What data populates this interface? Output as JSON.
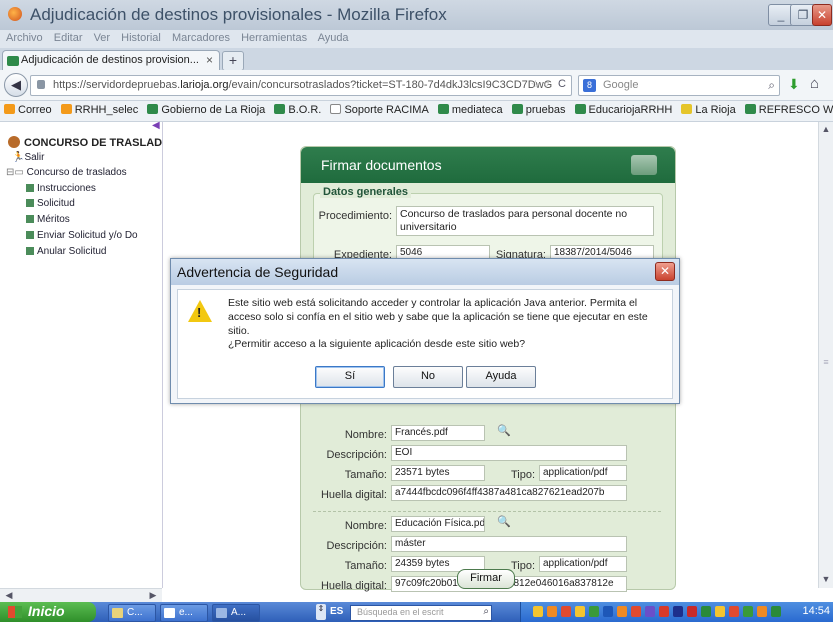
{
  "window": {
    "title": "Adjudicación de destinos provisionales - Mozilla Firefox",
    "minimize": "_",
    "restore": "❐",
    "close": "✕"
  },
  "menu": [
    "Archivo",
    "Editar",
    "Ver",
    "Historial",
    "Marcadores",
    "Herramientas",
    "Ayuda"
  ],
  "tab": {
    "label": "Adjudicación de destinos provision...",
    "close": "×",
    "new": "+"
  },
  "nav": {
    "url_prefix": "https://servidordepruebas.",
    "url_domain": "larioja.org",
    "url_suffix": "/evain/concursotraslados?ticket=ST-180-7d4dkJ3lcsI9C3CD7DwG",
    "search_engine": "Google"
  },
  "bookmarks": [
    {
      "label": "Correo",
      "icon": "o"
    },
    {
      "label": "RRHH_selec",
      "icon": "o"
    },
    {
      "label": "Gobierno de La Rioja",
      "icon": "g"
    },
    {
      "label": "B.O.R.",
      "icon": "g"
    },
    {
      "label": "Soporte RACIMA",
      "icon": "p"
    },
    {
      "label": "mediateca",
      "icon": "g"
    },
    {
      "label": "pruebas",
      "icon": "g"
    },
    {
      "label": "EducariojaRRHH",
      "icon": "g"
    },
    {
      "label": "La Rioja",
      "icon": "y"
    },
    {
      "label": "REFRESCO WEB",
      "icon": "g"
    }
  ],
  "sidebar": {
    "brand": "CONCURSO DE TRASLAD",
    "salir": "Salir",
    "root": "Concurso de traslados",
    "items": [
      "Instrucciones",
      "Solicitud",
      "Méritos",
      "Enviar Solicitud y/o Do",
      "Anular Solicitud"
    ]
  },
  "panel": {
    "title": "Firmar documentos",
    "legend": "Datos generales",
    "procedimiento_label": "Procedimiento:",
    "procedimiento_value": "Concurso de traslados para personal docente no universitario",
    "expediente_label": "Expediente:",
    "expediente_value": "5046",
    "signatura_label": "Signatura:",
    "signatura_value": "18387/2014/5046",
    "labels": {
      "nombre": "Nombre:",
      "descripcion": "Descripción:",
      "tamano": "Tamaño:",
      "tipo": "Tipo:",
      "huella": "Huella digital:"
    },
    "docs": [
      {
        "nombre": "Francés.pdf",
        "descripcion": "EOI",
        "tamano": "23571 bytes",
        "tipo": "application/pdf",
        "huella": "a7444fbcdc096f4ff4387a481ca827621ead207b"
      },
      {
        "nombre": "Educación Física.pd",
        "descripcion": "máster",
        "tamano": "24359 bytes",
        "tipo": "application/pdf",
        "huella": "97c09fc20b01960aa95026812e046016a837812e"
      }
    ],
    "firmar": "Firmar"
  },
  "dialog": {
    "title": "Advertencia de Seguridad",
    "message": "Este sitio web está solicitando acceder y controlar la aplicación Java anterior. Permita el acceso solo si confía en el sitio web y sabe que la aplicación se tiene que ejecutar en este sitio.",
    "question": "¿Permitir acceso a la siguiente aplicación desde este sitio web?",
    "yes": "Sí",
    "no": "No",
    "help": "Ayuda"
  },
  "taskbar": {
    "start": "Inicio",
    "tasks": [
      "C...",
      "e...",
      "A..."
    ],
    "lang": "ES",
    "search_placeholder": "Búsqueda en el escrit",
    "clock": "14:54"
  }
}
